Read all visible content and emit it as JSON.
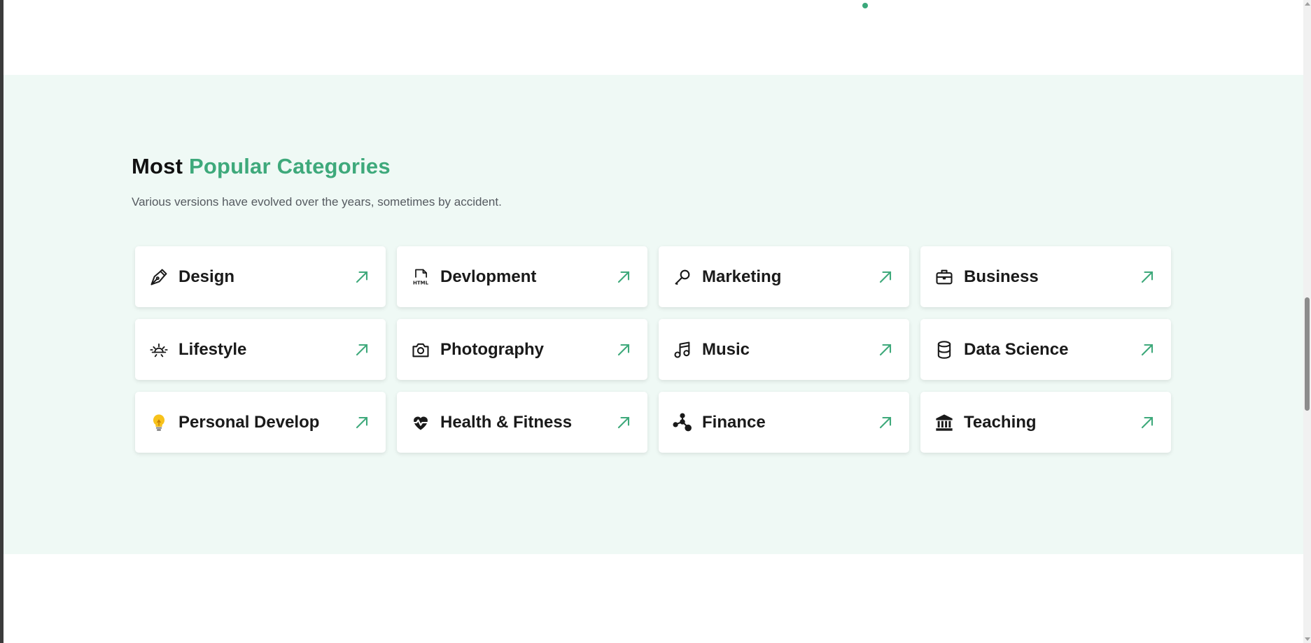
{
  "section": {
    "heading_prefix": "Most",
    "heading_accent": "Popular Categories",
    "subtitle": "Various versions have evolved over the years, sometimes by accident."
  },
  "colors": {
    "accent": "#3ea97b",
    "section_background": "#eff9f5",
    "card_background": "#ffffff"
  },
  "categories": [
    {
      "label": "Design",
      "icon": "pen-nib-icon"
    },
    {
      "label": "Devlopment",
      "icon": "html-file-icon"
    },
    {
      "label": "Marketing",
      "icon": "microphone-icon"
    },
    {
      "label": "Business",
      "icon": "briefcase-icon"
    },
    {
      "label": "Lifestyle",
      "icon": "sunrise-icon"
    },
    {
      "label": "Photography",
      "icon": "camera-icon"
    },
    {
      "label": "Music",
      "icon": "music-note-icon"
    },
    {
      "label": "Data Science",
      "icon": "database-icon"
    },
    {
      "label": "Personal Develop",
      "icon": "lightbulb-icon"
    },
    {
      "label": "Health & Fitness",
      "icon": "heartbeat-icon"
    },
    {
      "label": "Finance",
      "icon": "network-nodes-icon"
    },
    {
      "label": "Teaching",
      "icon": "institution-icon"
    }
  ],
  "card_arrow_icon": "arrow-up-right-icon"
}
